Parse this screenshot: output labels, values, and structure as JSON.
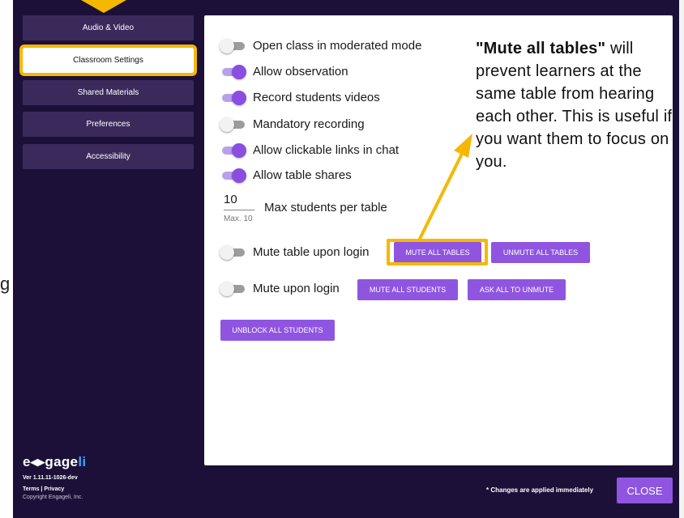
{
  "sidebar": {
    "items": [
      {
        "label": "Audio & Video"
      },
      {
        "label": "Classroom Settings",
        "active": true
      },
      {
        "label": "Shared Materials"
      },
      {
        "label": "Preferences"
      },
      {
        "label": "Accessibility"
      }
    ]
  },
  "settings": {
    "toggles": [
      {
        "label": "Open class in moderated mode",
        "on": false
      },
      {
        "label": "Allow observation",
        "on": true
      },
      {
        "label": "Record students videos",
        "on": true
      },
      {
        "label": "Mandatory recording",
        "on": false
      },
      {
        "label": "Allow clickable links in chat",
        "on": true
      },
      {
        "label": "Allow table shares",
        "on": true
      }
    ],
    "max_students": {
      "value": "10",
      "hint": "Max. 10",
      "label": "Max students per table"
    },
    "mute_table": {
      "label": "Mute table upon login",
      "on": false
    },
    "mute_user": {
      "label": "Mute upon login",
      "on": false
    },
    "buttons": {
      "mute_all_tables": "MUTE ALL TABLES",
      "unmute_all_tables": "UNMUTE ALL TABLES",
      "mute_all_students": "MUTE ALL STUDENTS",
      "ask_all_to_unmute": "ASK ALL TO UNMUTE",
      "unblock_all_students": "UNBLOCK ALL STUDENTS"
    }
  },
  "callout": {
    "bold": "\"Mute all tables\"",
    "text": " will prevent learners at the same table from hearing each other. This is useful if you want them to focus on you."
  },
  "footer": {
    "logo_main": "e◂▸gage",
    "logo_accent": "li",
    "version": "Ver 1.11.11-1026-dev",
    "legal": "Terms | Privacy",
    "copyright": "Copyright Engageli, Inc.",
    "note": "* Changes are applied immediately",
    "close": "CLOSE"
  },
  "stray": {
    "char": "g"
  },
  "colors": {
    "accent": "#8f55e0",
    "highlight": "#f5b800",
    "background": "#1c1038"
  }
}
